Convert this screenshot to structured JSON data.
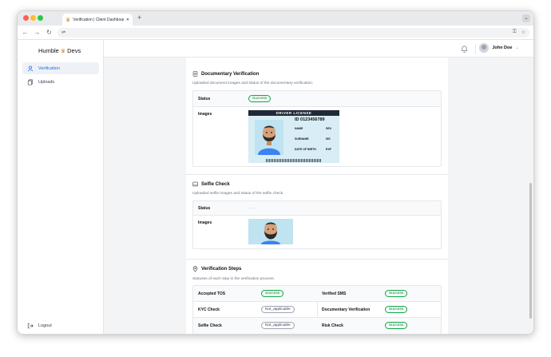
{
  "browser": {
    "tab_title": "Verification | Client Dashboard",
    "tab_close": "✕",
    "new_tab": "+"
  },
  "app": {
    "brand_word1": "Humble",
    "brand_word2": "Devs"
  },
  "sidebar": {
    "items": [
      {
        "label": "Verification",
        "icon": "user-check-icon",
        "active": true
      },
      {
        "label": "Uploads",
        "icon": "copy-icon",
        "active": false
      }
    ],
    "logout_label": "Logout"
  },
  "header": {
    "user_name": "John Doe"
  },
  "documentary": {
    "title": "Documentary Verification",
    "description": "Uploaded document images and status of the documentary verification.",
    "status_label": "Status",
    "status_value": "Success",
    "images_label": "Images",
    "license": {
      "band": "DRIVER LICENSE",
      "id_number": "ID 0123456789",
      "name": "NAME",
      "sex": "SEX",
      "surname": "SURNAME",
      "iss": "ISS",
      "dob": "DATE OF BIRTH",
      "exp": "EXP"
    }
  },
  "selfie": {
    "title": "Selfie Check",
    "description": "Uploaded selfie images and status of the selfie check.",
    "status_label": "Status",
    "status_value": "——",
    "images_label": "Images"
  },
  "steps": {
    "title": "Verification Steps",
    "description": "Statuses of each step in the verification process.",
    "rows": [
      {
        "left_label": "Accepted TOS",
        "left_status": "Success",
        "right_label": "Verified SMS",
        "right_status": "Success"
      },
      {
        "left_label": "KYC Check",
        "left_status": "Not_applicable",
        "right_label": "Documentary Verification",
        "right_status": "Success"
      },
      {
        "left_label": "Selfie Check",
        "left_status": "Not_applicable",
        "right_label": "Risk Check",
        "right_status": "Success"
      }
    ]
  },
  "colors": {
    "success": "#16a34a",
    "accent": "#2563eb",
    "brand_crown": "#d28b26"
  }
}
